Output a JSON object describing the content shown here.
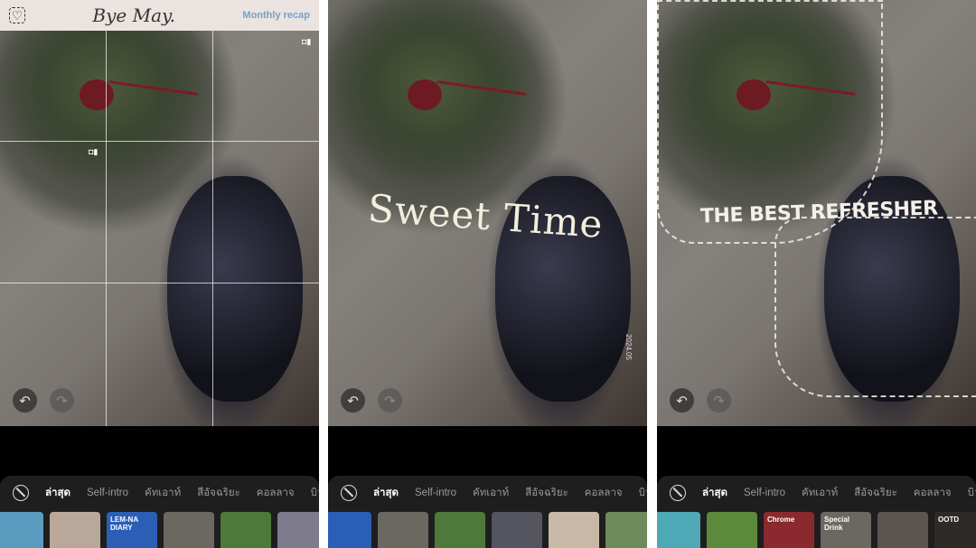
{
  "header": {
    "logo": "Bye May.",
    "recap_link": "Monthly recap"
  },
  "tabs": [
    "ล่าสุด",
    "Self-intro",
    "คัทเอาท์",
    "สีอัจฉริยะ",
    "คอลลาจ",
    "บิวตี้"
  ],
  "panels": [
    {
      "sticker": "",
      "thumbs": [
        {
          "label": "",
          "color": "#5a9cc0"
        },
        {
          "label": "",
          "color": "#b9a89a"
        },
        {
          "label": "LEM-NA DIARY",
          "color": "#2b5fb5"
        },
        {
          "label": "",
          "color": "#6b6761"
        },
        {
          "label": "",
          "color": "#4d7a3a"
        },
        {
          "label": "",
          "color": "#7d7b8c"
        },
        {
          "label": "",
          "color": "#b0a79c"
        }
      ]
    },
    {
      "sticker": "Sweet Time",
      "date": "2024.05",
      "thumbs": [
        {
          "label": "",
          "color": "#2b5fb5"
        },
        {
          "label": "",
          "color": "#6b6761"
        },
        {
          "label": "",
          "color": "#4d7a3a"
        },
        {
          "label": "",
          "color": "#555560"
        },
        {
          "label": "",
          "color": "#c8b9a6"
        },
        {
          "label": "",
          "color": "#6d8a5a"
        },
        {
          "label": "",
          "color": "#3f6fa8"
        }
      ]
    },
    {
      "sticker": "THE BEST REFRESHER",
      "thumbs": [
        {
          "label": "",
          "color": "#4fa8b5"
        },
        {
          "label": "",
          "color": "#5c8a3a"
        },
        {
          "label": "Chrome",
          "color": "#8a2a2e"
        },
        {
          "label": "Special Drink",
          "color": "#6b6761"
        },
        {
          "label": "",
          "color": "#5a5550"
        },
        {
          "label": "OOTD",
          "color": "#2e2a28"
        },
        {
          "label": "",
          "color": "#cfc6bc"
        }
      ]
    }
  ],
  "colors": {
    "accent": "#6ea3cf",
    "sheet": "#1e1e1e"
  }
}
